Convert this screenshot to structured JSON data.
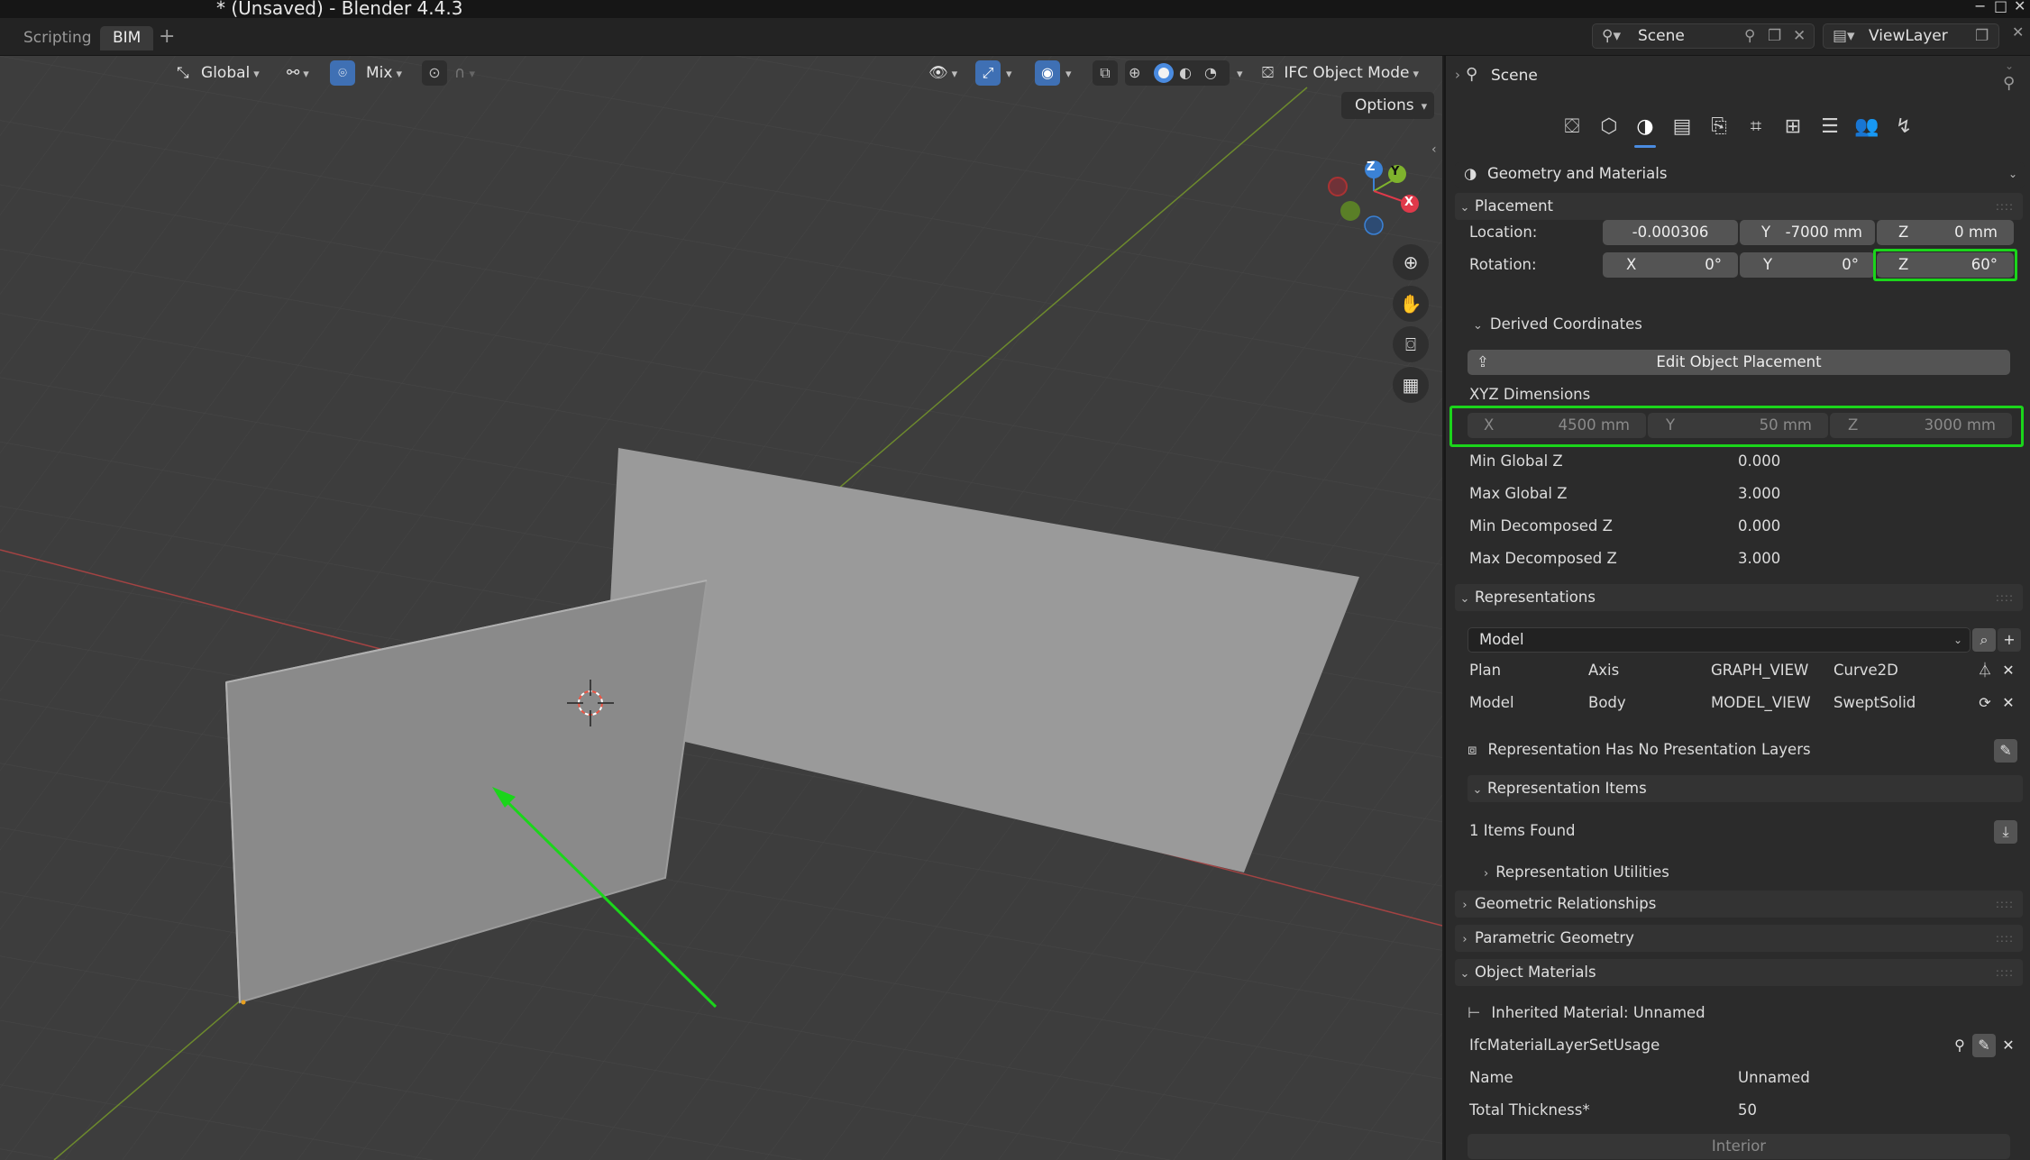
{
  "window": {
    "title": "* (Unsaved) - Blender 4.4.3",
    "controls": [
      "−",
      "□",
      "✕"
    ]
  },
  "workspace_tabs": [
    {
      "label": "Scripting",
      "active": false
    },
    {
      "label": "BIM",
      "active": true
    }
  ],
  "workspace_add": "+",
  "scene_selector": {
    "value": "Scene",
    "icon": "scene-icon"
  },
  "viewlayer_selector": {
    "value": "ViewLayer",
    "icon": "viewlayer-icon"
  },
  "viewport_header": {
    "transform_orientation": "Global",
    "snap_target": "Mix",
    "mode": "IFC Object Mode",
    "options_label": "Options"
  },
  "gizmo_axes": {
    "x": "X",
    "y": "Y",
    "z": "Z"
  },
  "properties": {
    "header_title": "Scene",
    "tabs": [
      "bim-project-tab",
      "object-tab",
      "geometry-tab",
      "stack-tab",
      "services-tab",
      "structural-tab",
      "quality-tab",
      "layers-tab",
      "people-tab",
      "analysis-tab"
    ],
    "active_tab_index": 2,
    "category": "Geometry and Materials",
    "placement": {
      "header": "Placement",
      "location_label": "Location:",
      "location": [
        {
          "axis": "",
          "value": "-0.000306"
        },
        {
          "axis": "Y",
          "value": "-7000 mm"
        },
        {
          "axis": "Z",
          "value": "0 mm"
        }
      ],
      "rotation_label": "Rotation:",
      "rotation": [
        {
          "axis": "X",
          "value": "0°"
        },
        {
          "axis": "Y",
          "value": "0°"
        },
        {
          "axis": "Z",
          "value": "60°"
        }
      ]
    },
    "derived": {
      "header": "Derived Coordinates",
      "edit_button": "Edit Object Placement",
      "xyz_label": "XYZ Dimensions",
      "xyz": [
        {
          "axis": "X",
          "value": "4500 mm"
        },
        {
          "axis": "Y",
          "value": "50 mm"
        },
        {
          "axis": "Z",
          "value": "3000 mm"
        }
      ],
      "stats": [
        {
          "label": "Min Global Z",
          "value": "0.000"
        },
        {
          "label": "Max Global Z",
          "value": "3.000"
        },
        {
          "label": "Min Decomposed Z",
          "value": "0.000"
        },
        {
          "label": "Max Decomposed Z",
          "value": "3.000"
        }
      ]
    },
    "representations": {
      "header": "Representations",
      "context_dropdown": "Model",
      "rows": [
        {
          "context": "Plan",
          "identifier": "Axis",
          "target_view": "GRAPH_VIEW",
          "type": "Curve2D"
        },
        {
          "context": "Model",
          "identifier": "Body",
          "target_view": "MODEL_VIEW",
          "type": "SweptSolid"
        }
      ],
      "no_layers": "Representation Has No Presentation Layers",
      "items_header": "Representation Items",
      "items_found": "1 Items Found",
      "utilities_header": "Representation Utilities"
    },
    "geometric_relationships": "Geometric Relationships",
    "parametric_geometry": "Parametric Geometry",
    "object_materials": {
      "header": "Object Materials",
      "inherited": "Inherited Material: Unnamed",
      "usage": "IfcMaterialLayerSetUsage",
      "fields": [
        {
          "label": "Name",
          "value": "Unnamed"
        },
        {
          "label": "Total Thickness*",
          "value": "50"
        }
      ],
      "interior_button": "Interior"
    }
  },
  "colors": {
    "accent_blue": "#4a8be0",
    "highlight_green": "#1bd51b",
    "axis_x": "#e0394a",
    "axis_y": "#7fb32d",
    "axis_z": "#3b82d6"
  }
}
